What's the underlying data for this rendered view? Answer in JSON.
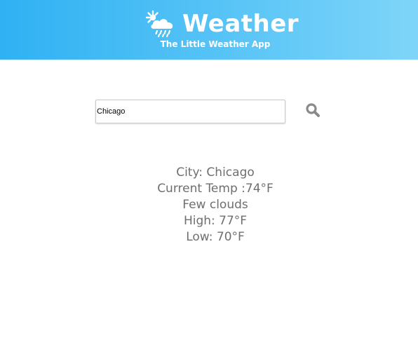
{
  "header": {
    "title": "Weather",
    "subtitle": "The Little Weather App",
    "logo_icon": "sun-cloud-rain-icon",
    "background_colors": [
      "#2fb1f3",
      "#7fd5f9"
    ]
  },
  "search": {
    "value": "Chicago",
    "button_icon": "search-icon",
    "button_color": "#8a8a8a"
  },
  "weather": {
    "city": "City: Chicago",
    "current_temp": "Current Temp :74°F",
    "description": "Few clouds",
    "high": "High: 77°F",
    "low": "Low: 70°F",
    "text_color": "#6f6f6f"
  }
}
